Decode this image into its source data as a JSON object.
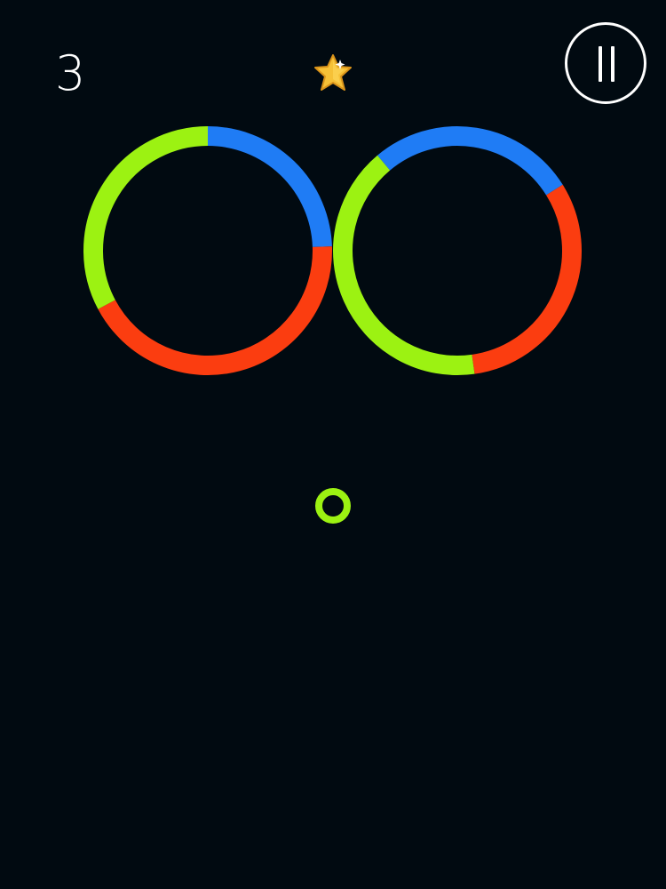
{
  "hud": {
    "score": "3"
  },
  "icons": {
    "pause": "pause-icon",
    "star": "star-icon"
  },
  "colors": {
    "background": "#010a11",
    "blue": "#1f7cf5",
    "red": "#fb3d10",
    "lime": "#9cf212",
    "white": "#ffffff",
    "star_fill": "#f6c137",
    "star_stroke": "#d9931a"
  },
  "obstacles": [
    {
      "name": "ring-obstacle-left",
      "segments": [
        {
          "color": "blue",
          "from_deg": 270,
          "to_deg": 358
        },
        {
          "color": "red",
          "from_deg": 358,
          "to_deg": 152
        },
        {
          "color": "lime",
          "from_deg": 152,
          "to_deg": 270
        }
      ]
    },
    {
      "name": "ring-obstacle-right",
      "segments": [
        {
          "color": "blue",
          "from_deg": 230,
          "to_deg": 328
        },
        {
          "color": "red",
          "from_deg": 328,
          "to_deg": 82
        },
        {
          "color": "lime",
          "from_deg": 82,
          "to_deg": 230
        }
      ]
    }
  ],
  "player": {
    "color": "lime"
  }
}
